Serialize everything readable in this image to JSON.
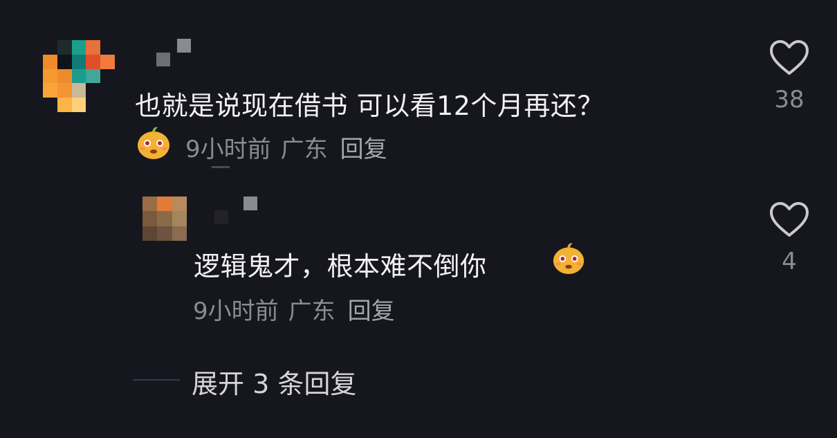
{
  "comment": {
    "text": "也就是说现在借书 可以看12个月再还？",
    "time": "9小时前",
    "location": "广东",
    "reply_label": "回复",
    "like_count": "38"
  },
  "reply": {
    "text": "逻辑鬼才，根本难不倒你",
    "time": "9小时前",
    "location": "广东",
    "reply_label": "回复",
    "like_count": "4"
  },
  "expand": {
    "label": "展开 3 条回复"
  },
  "icons": {
    "like": "heart-outline-icon",
    "emoji": "smiling-face-emoji"
  },
  "colors": {
    "background": "#16161e",
    "text": "#f2f2f4",
    "meta": "#8b8b93",
    "emoji": "#f2b233"
  }
}
